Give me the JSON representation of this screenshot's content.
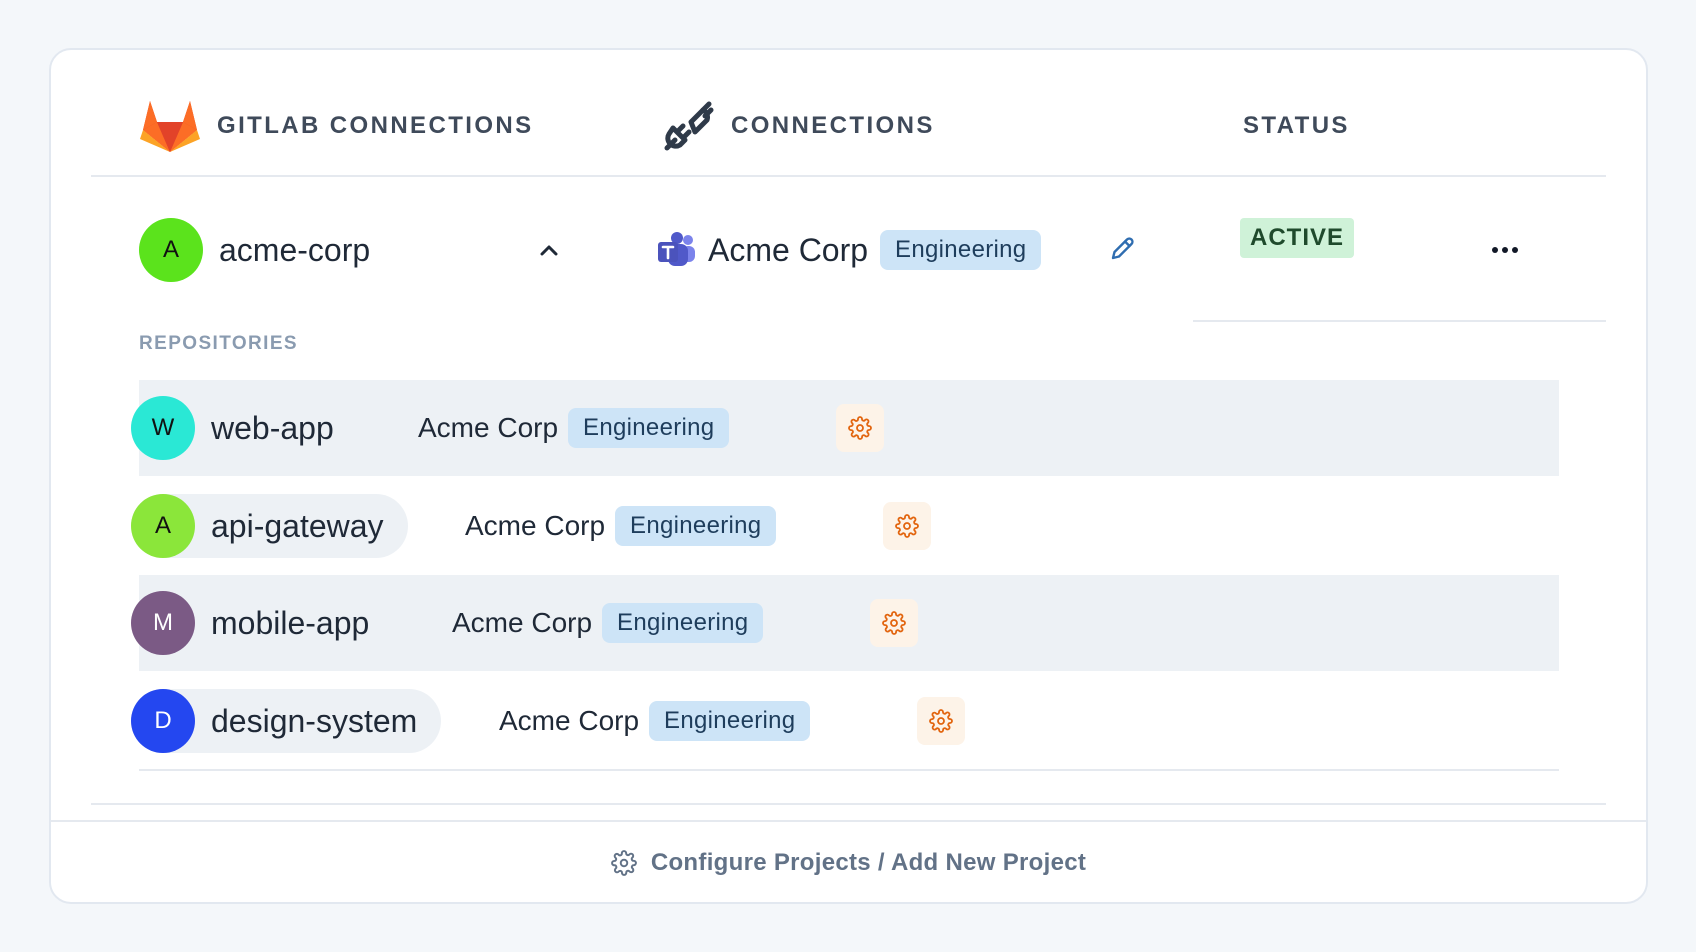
{
  "header": {
    "gitlab_title": "GITLAB CONNECTIONS",
    "connections_title": "CONNECTIONS",
    "status_title": "STATUS"
  },
  "org": {
    "avatar_letter": "A",
    "avatar_color": "#5be31c",
    "name": "acme-corp",
    "connection_name": "Acme Corp",
    "connection_tag": "Engineering",
    "status": "ACTIVE"
  },
  "repositories_label": "REPOSITORIES",
  "repositories": [
    {
      "avatar_letter": "W",
      "avatar_color": "#2ae8d5",
      "name": "web-app",
      "connection_name": "Acme Corp",
      "connection_tag": "Engineering"
    },
    {
      "avatar_letter": "A",
      "avatar_color": "#8be63a",
      "name": "api-gateway",
      "connection_name": "Acme Corp",
      "connection_tag": "Engineering"
    },
    {
      "avatar_letter": "M",
      "avatar_color": "#7b5a85",
      "name": "mobile-app",
      "connection_name": "Acme Corp",
      "connection_tag": "Engineering"
    },
    {
      "avatar_letter": "D",
      "avatar_color": "#2447f0",
      "name": "design-system",
      "connection_name": "Acme Corp",
      "connection_tag": "Engineering"
    }
  ],
  "footer": {
    "label": "Configure Projects / Add New Project"
  },
  "icons": {
    "gitlab": "gitlab-logo-icon",
    "connections": "plug-icon",
    "teams": "microsoft-teams-icon",
    "expand": "chevron-up-icon",
    "edit": "pencil-icon",
    "more": "more-horizontal-icon",
    "settings": "gear-icon"
  },
  "colors": {
    "tag_bg": "#cde4f7",
    "status_bg": "#cff2d8",
    "gear_accent": "#e2650f"
  }
}
